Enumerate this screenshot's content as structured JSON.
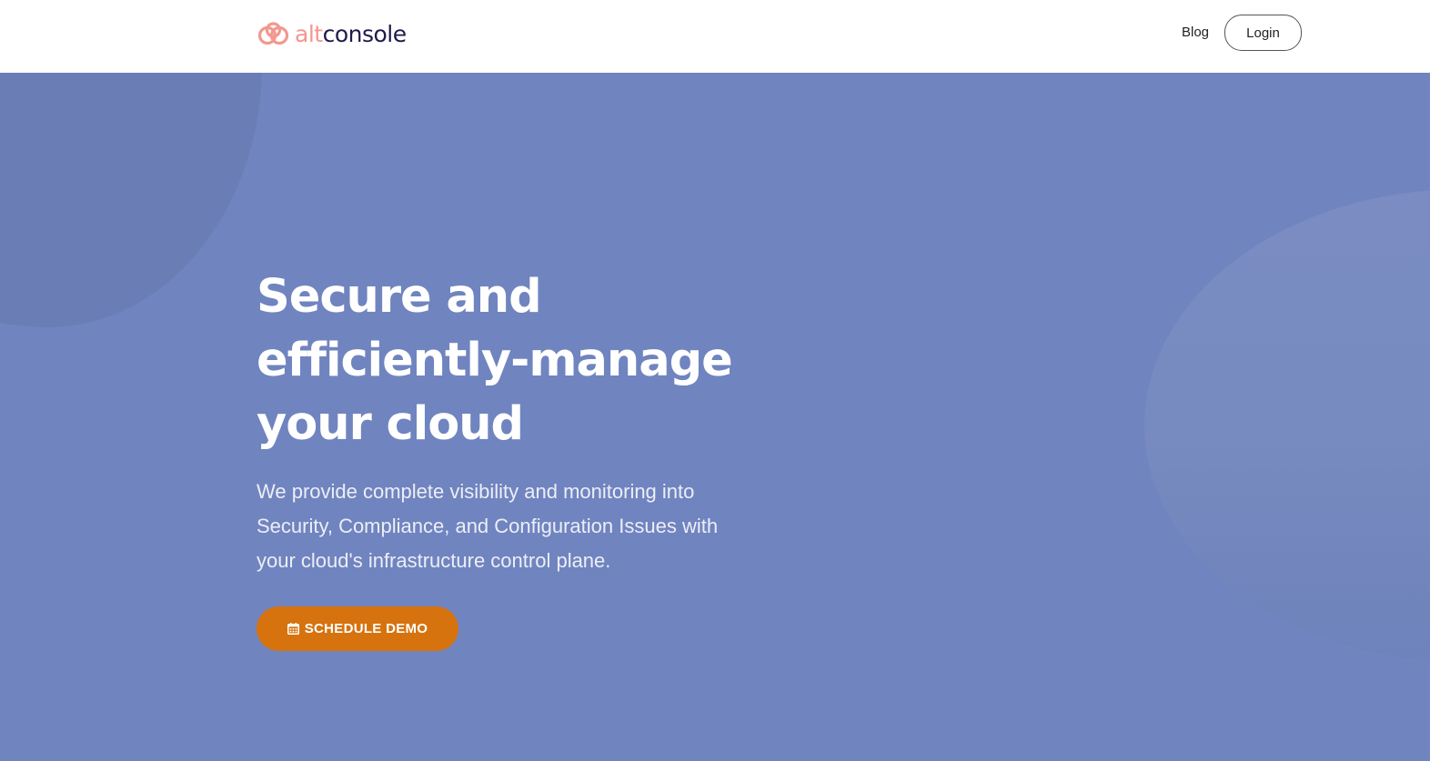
{
  "header": {
    "logo": {
      "part1": "alt",
      "part2": "console"
    },
    "nav": {
      "blog_label": "Blog",
      "login_label": "Login"
    }
  },
  "hero": {
    "title": "Secure and efficiently-manage your cloud",
    "description": "We provide complete visibility and monitoring into Security, Compliance, and Configuration Issues with your cloud's infrastructure control plane.",
    "cta": {
      "icon": "calendar-icon",
      "label": "SCHEDULE DEMO"
    }
  },
  "colors": {
    "brand_coral": "#f4978e",
    "brand_navy": "#1e1b4b",
    "hero_background": "#7084bf",
    "cta_background": "#d6730e",
    "text_white": "#ffffff"
  }
}
